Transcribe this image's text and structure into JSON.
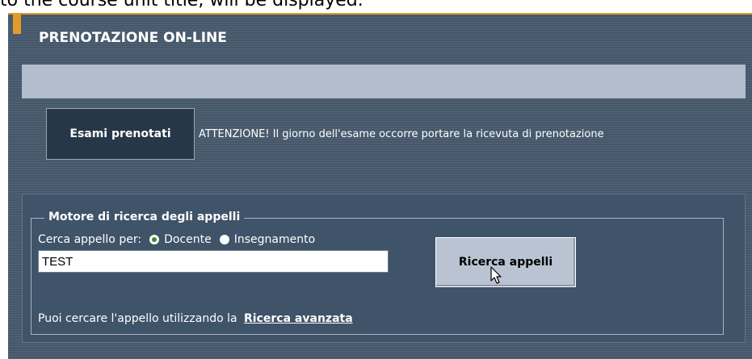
{
  "caption": "to the course unit title, will be displayed.",
  "header": {
    "title": "PRENOTAZIONE ON-LINE"
  },
  "actions": {
    "booked_exams_label": "Esami prenotati",
    "attention_text": "ATTENZIONE! Il giorno dell'esame occorre portare la ricevuta di prenotazione"
  },
  "search": {
    "legend": "Motore di ricerca degli appelli",
    "search_by_label": "Cerca appello per:",
    "options": [
      {
        "label": "Docente",
        "selected": true
      },
      {
        "label": "Insegnamento",
        "selected": false
      }
    ],
    "input_value": "TEST",
    "button_label": "Ricerca appelli",
    "advanced_prefix": "Puoi cercare l'appello utilizzando la",
    "advanced_link": "Ricerca avanzata"
  },
  "colors": {
    "panel": "#45576a",
    "accent": "#e39a2c",
    "grey_band": "#b3bdce",
    "button_dark": "#283747",
    "button_light": "#b9c3d2"
  }
}
